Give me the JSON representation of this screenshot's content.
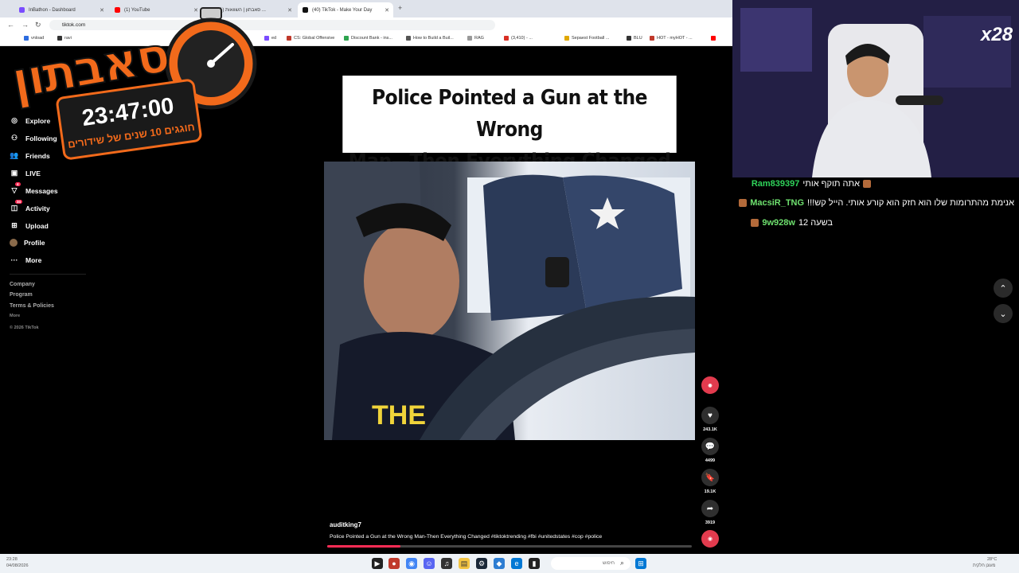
{
  "browser": {
    "tabs": [
      {
        "label": "InBathon - Dashboard",
        "color": "#7a4cff"
      },
      {
        "label": "(1) YouTube",
        "color": "#ff0000"
      },
      {
        "label": "(1) סאבתון | השוואות ...",
        "color": "#ff4d6d"
      },
      {
        "label": "(40) TikTok - Make Your Day",
        "color": "#111111"
      }
    ],
    "url": "tiktok.com",
    "bookmarks": [
      "vnload",
      "ravi",
      "ed",
      "CS: Global Offensive",
      "Discount Bank - ins...",
      "How to Build a Buil...",
      "RAG",
      "(3,410) - ...",
      "Sepaest Football ...",
      "BLU",
      "HOT - myHOT - ..."
    ]
  },
  "sidebar": {
    "items": [
      {
        "label": "Explore",
        "icon": "compass-icon"
      },
      {
        "label": "Following",
        "icon": "following-icon"
      },
      {
        "label": "Friends",
        "icon": "friends-icon"
      },
      {
        "label": "LIVE",
        "icon": "live-icon"
      },
      {
        "label": "Messages",
        "icon": "messages-icon",
        "badge": "4"
      },
      {
        "label": "Activity",
        "icon": "activity-icon",
        "badge": "34"
      },
      {
        "label": "Upload",
        "icon": "upload-icon"
      },
      {
        "label": "Profile",
        "icon": "avatar"
      },
      {
        "label": "More",
        "icon": "more-icon"
      }
    ],
    "footer": [
      "Company",
      "Program",
      "Terms & Policies"
    ],
    "more_small": "More",
    "copyright": "© 2026 TikTok"
  },
  "video": {
    "title_line1": "Police Pointed a Gun at the Wrong",
    "title_line2": "Man—Then Everything Changed",
    "username": "auditking7",
    "caption": "Police Pointed a Gun at the Wrong Man-Then Everything Changed #tiktoktrending #fbi #unitedstates #cop #police",
    "progress": 0.2,
    "likes": "243.1K",
    "comments": "4499",
    "saves": "19.1K",
    "shares": "3919"
  },
  "overlay": {
    "logo_text": "סאבתון",
    "timer": "23:47:00",
    "subtitle": "חוגגים 10 שנים של שידורים",
    "multiplier": "x28"
  },
  "chat": {
    "messages": [
      {
        "nick": "Ram839397",
        "text": "אתה תוקף אותי"
      },
      {
        "nick": "MacsiR_TNG",
        "text": "!!!אנימת מהתרומות שלו הוא חזק הוא קורע אותי. הייל קש"
      },
      {
        "nick": "9w928w",
        "text": "12 בשעה"
      }
    ]
  },
  "taskbar": {
    "time": "23:28",
    "date": "04/08/2026",
    "search_placeholder": "חיפוש",
    "weather": "28°C",
    "weather_desc": "מעונן חלקית"
  }
}
